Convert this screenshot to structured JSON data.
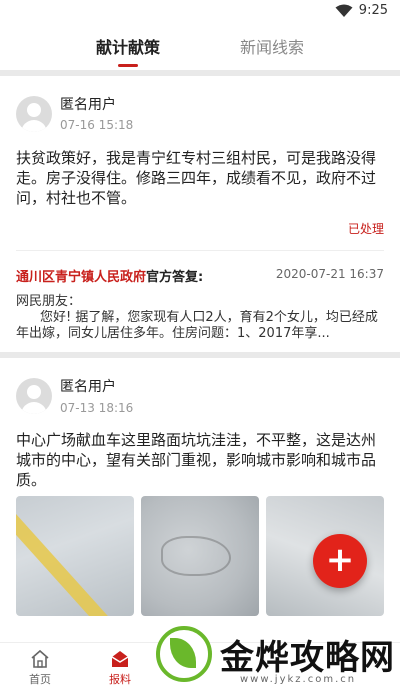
{
  "status_bar": {
    "time": "9:25",
    "wifi_icon": "wifi-icon"
  },
  "tabs": {
    "active": "献计献策",
    "inactive": "新闻线索"
  },
  "posts": [
    {
      "user": "匿名用户",
      "time": "07-16 15:18",
      "text": "扶贫政策好，我是青宁红专村三组村民，可是我路没得走。房子没得住。修路三四年，成绩看不见，政府不过问，村社也不管。",
      "status": "已处理",
      "reply": {
        "org": "通川区青宁镇人民政府",
        "label": "官方答复:",
        "time": "2020-07-21 16:37",
        "greeting": "网民朋友：",
        "body": "您好! 据了解，您家现有人口2人，育有2个女儿，均已经成年出嫁，同女儿居住多年。住房问题：1、2017年享..."
      }
    },
    {
      "user": "匿名用户",
      "time": "07-13 18:16",
      "text": "中心广场献血车这里路面坑坑洼洼，不平整，这是达州城市的中心，望有关部门重视，影响城市影响和城市品质。"
    }
  ],
  "fab": {
    "label": "+"
  },
  "bottom_nav": [
    {
      "label": "首页",
      "icon": "home-icon"
    },
    {
      "label": "报料",
      "icon": "report-icon"
    }
  ],
  "watermark": {
    "text": "金烨攻略网",
    "url": "www.jykz.com.cn"
  },
  "colors": {
    "accent": "#c8201c",
    "fab": "#e2231a",
    "watermark_green": "#6ab82b"
  }
}
